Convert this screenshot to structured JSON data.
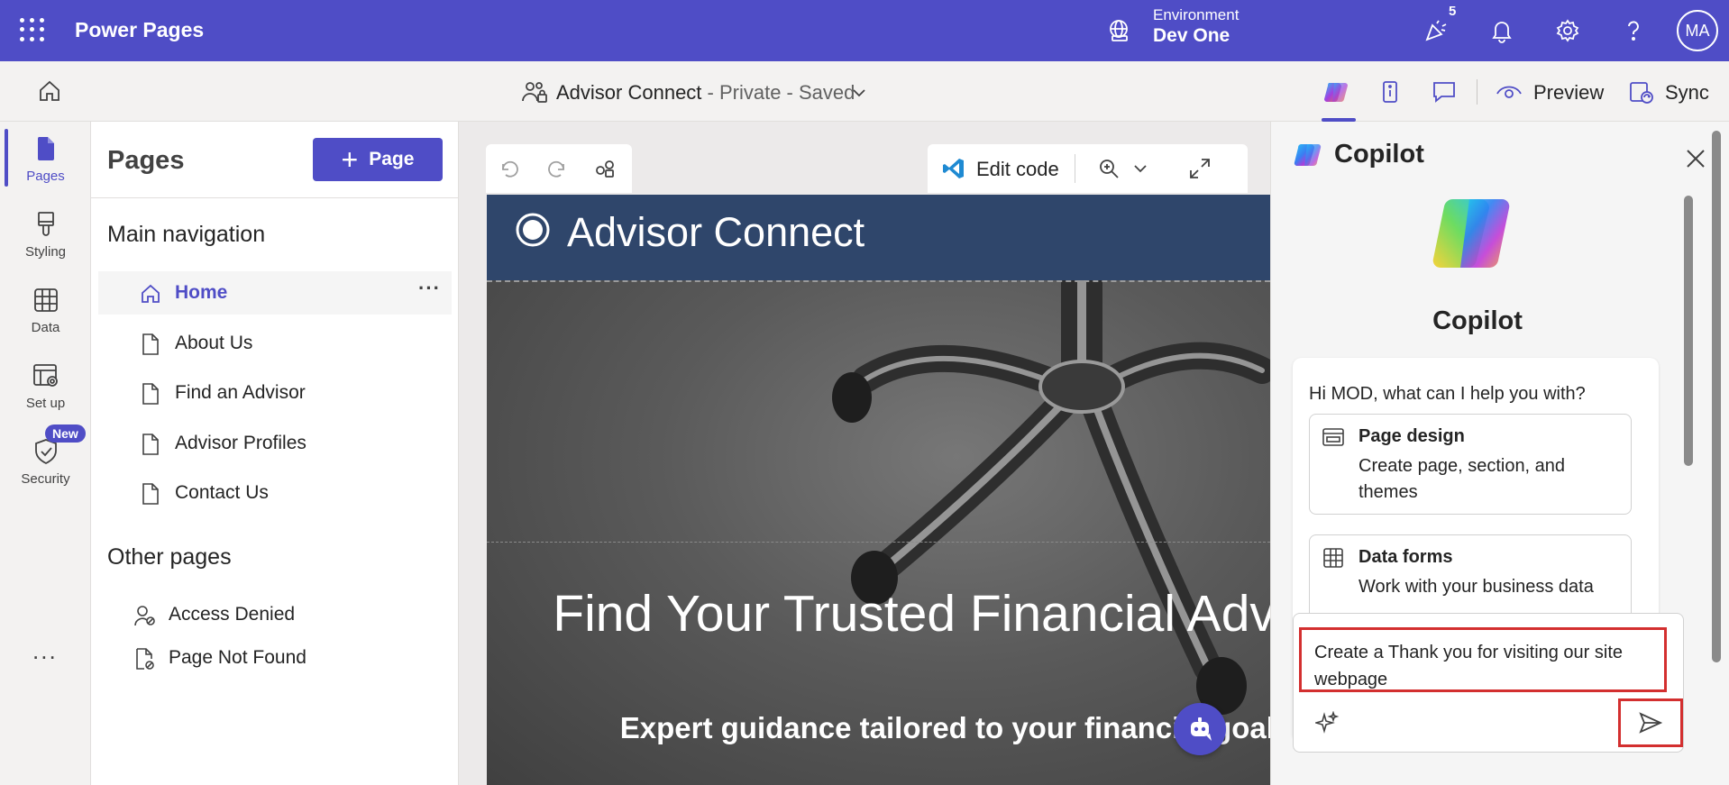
{
  "topbar": {
    "app_name": "Power Pages",
    "environment_label": "Environment",
    "environment_value": "Dev One",
    "notification_count": "5",
    "avatar_initials": "MA"
  },
  "cmdbar": {
    "site_name": "Advisor Connect",
    "site_status": " - Private - Saved",
    "preview_label": "Preview",
    "sync_label": "Sync"
  },
  "rail": {
    "items": [
      {
        "label": "Pages",
        "icon": "page-icon"
      },
      {
        "label": "Styling",
        "icon": "paintbrush-icon"
      },
      {
        "label": "Data",
        "icon": "table-icon"
      },
      {
        "label": "Set up",
        "icon": "settings-table-icon"
      },
      {
        "label": "Security",
        "icon": "shield-icon"
      }
    ],
    "new_badge": "New",
    "more": "..."
  },
  "pages_panel": {
    "title": "Pages",
    "add_button": "Page",
    "main_nav_heading": "Main navigation",
    "main_nav": [
      "Home",
      "About Us",
      "Find an Advisor",
      "Advisor Profiles",
      "Contact Us"
    ],
    "other_heading": "Other pages",
    "other_pages": [
      "Access Denied",
      "Page Not Found"
    ],
    "item_more": "···"
  },
  "canvas": {
    "edit_code_label": "Edit code",
    "site_header_name": "Advisor Connect",
    "hero_title": "Find Your Trusted Financial Advisor",
    "hero_subtitle": "Expert guidance tailored to your financial goals"
  },
  "copilot": {
    "header_title": "Copilot",
    "name": "Copilot",
    "greeting": "Hi MOD, what can I help you with?",
    "options": [
      {
        "title": "Page design",
        "desc": "Create page, section, and themes"
      },
      {
        "title": "Data forms",
        "desc": "Work with your business data"
      }
    ],
    "input_text": "Create a Thank you for visiting our site webpage"
  },
  "colors": {
    "brand": "#4f4dc6",
    "site_header": "#2f466b",
    "highlight_border": "#d32f2f"
  }
}
